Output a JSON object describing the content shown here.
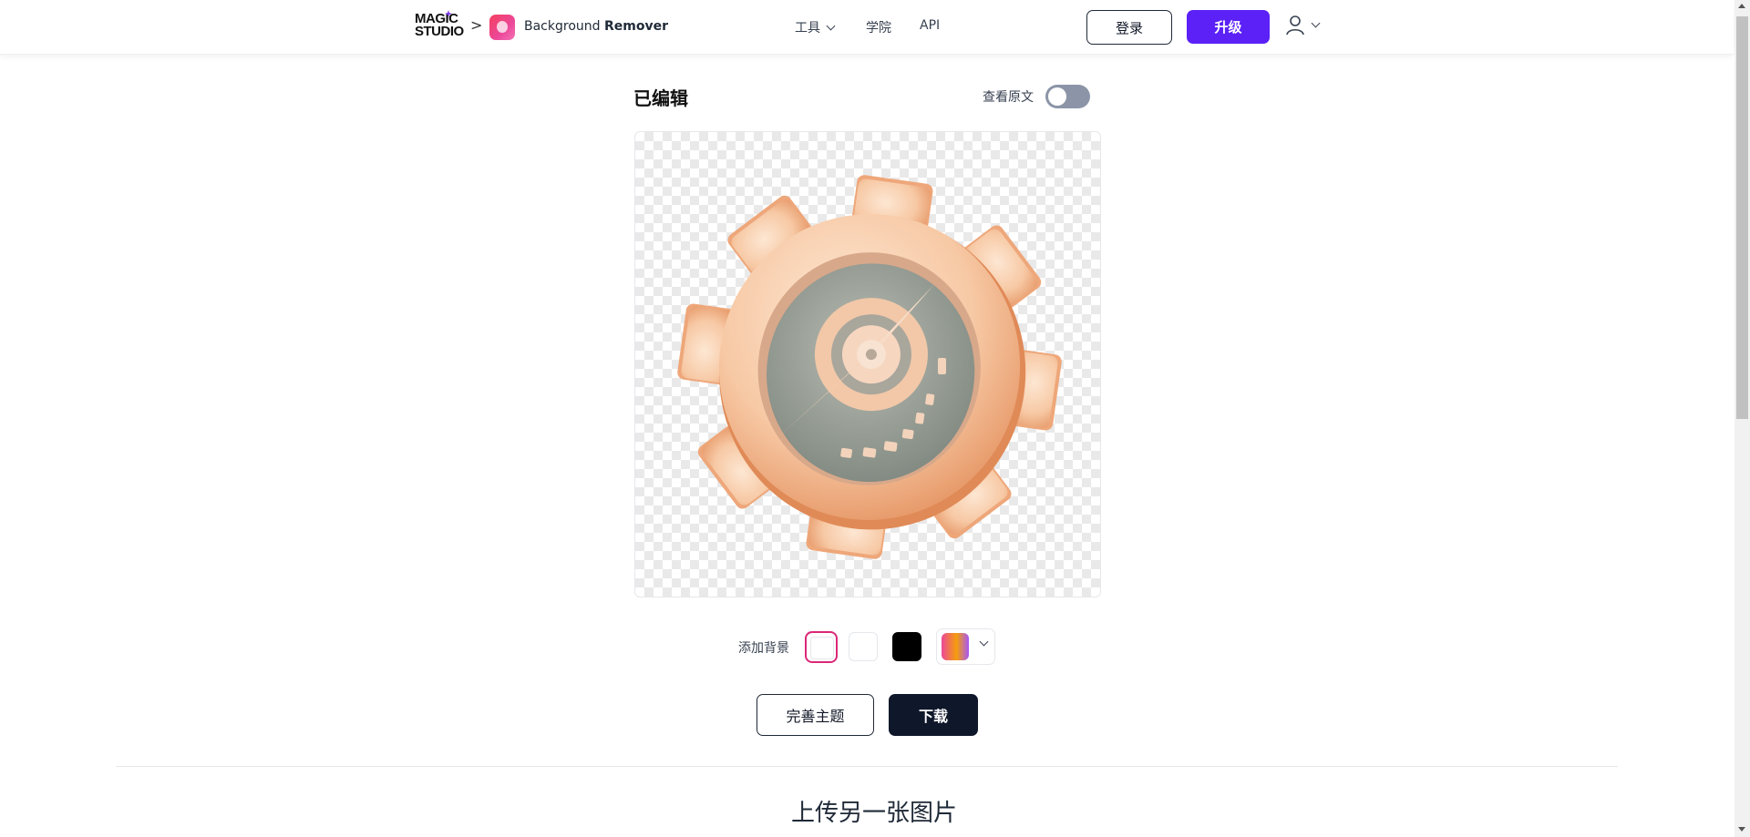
{
  "header": {
    "logo": {
      "line1": "MAGIC",
      "line2": "STUDIO"
    },
    "breadcrumb_separator": ">",
    "app_name_prefix": "Background",
    "app_name_bold": "Remover",
    "nav": {
      "tools": "工具",
      "academy": "学院",
      "api": "API"
    },
    "login_label": "登录",
    "upgrade_label": "升级"
  },
  "editor": {
    "title": "已编辑",
    "toggle_label": "查看原文",
    "toggle_on": false,
    "image_subject": "3D peach gear with gauge needle, background removed"
  },
  "background_picker": {
    "label": "添加背景",
    "options": [
      "transparent",
      "white",
      "black",
      "gradient"
    ],
    "selected": "transparent",
    "colors": {
      "white": "#ffffff",
      "black": "#000000",
      "selected_border": "#db2777"
    }
  },
  "actions": {
    "refine_label": "完善主题",
    "download_label": "下载"
  },
  "upload_section": {
    "title": "上传另一张图片"
  },
  "theme": {
    "accent": "#5b21f6",
    "dark_button": "#0f172a"
  }
}
